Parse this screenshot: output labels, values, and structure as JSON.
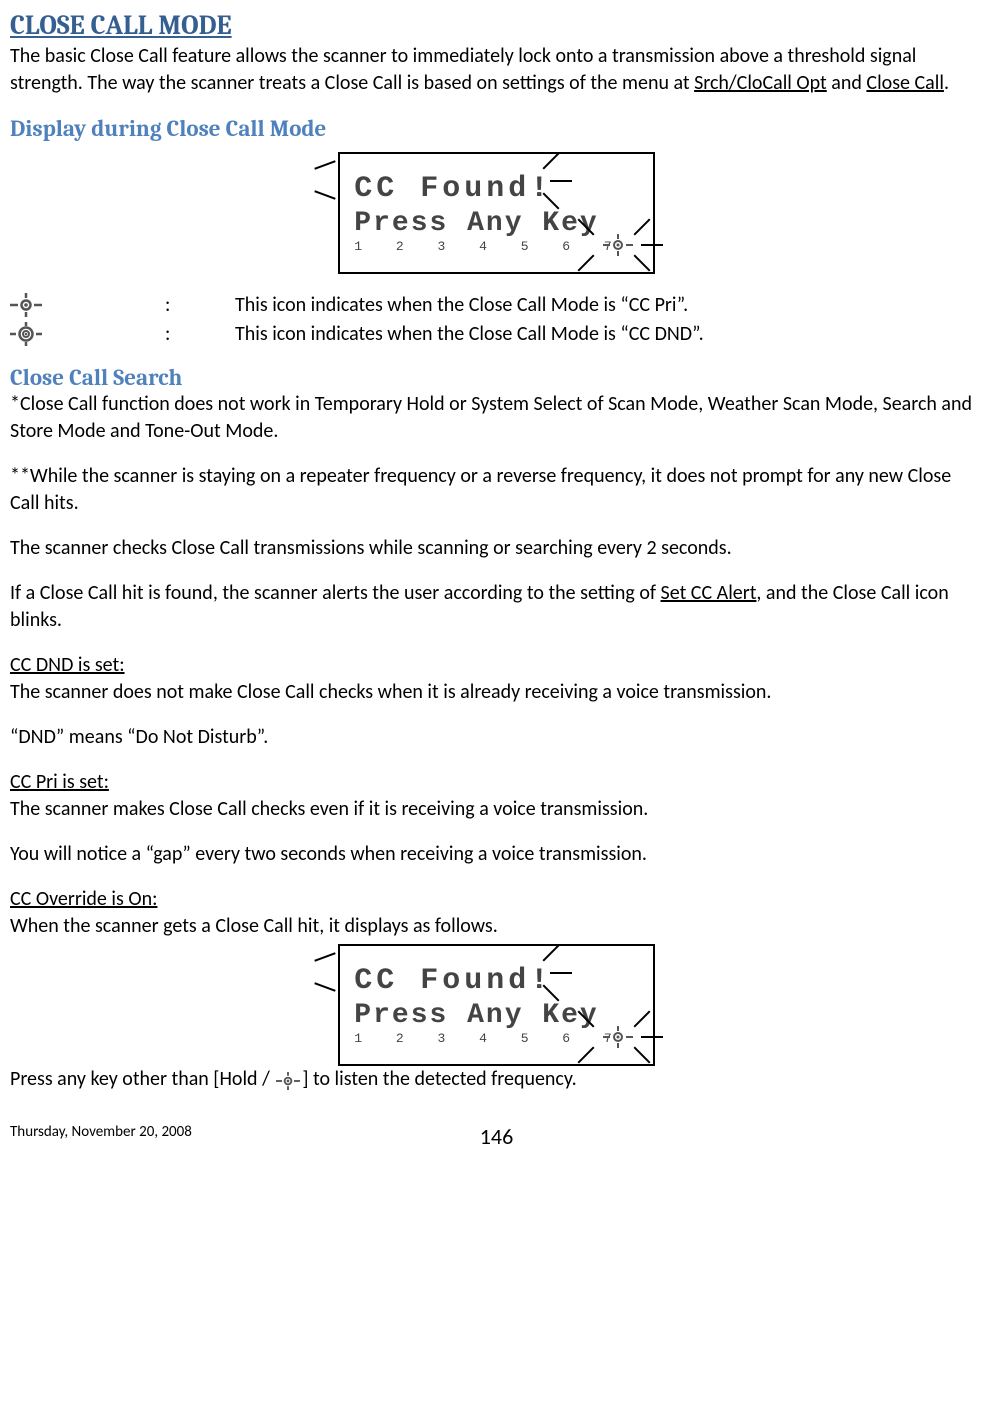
{
  "title": "CLOSE CALL MODE",
  "intro_1": "The basic Close Call feature allows the scanner to immediately lock onto a transmission above a threshold signal strength. The way the scanner treats a Close Call is based on settings of the menu at ",
  "intro_link1": "Srch/CloCall Opt",
  "intro_and": " and ",
  "intro_link2": "Close Call",
  "intro_end": ".",
  "h2_display": "Display during Close Call Mode",
  "lcd1_line1": "CC Found!",
  "lcd1_line2": "Press Any Key",
  "lcd1_line3": "1 2 3 4 5 6 7",
  "icon_row1_colon": ":",
  "icon_row1_desc": "This icon indicates when the Close Call Mode is “CC Pri”.",
  "icon_row2_colon": ":",
  "icon_row2_desc": "This icon indicates when the Close Call Mode is “CC DND”.",
  "h2_search": "Close Call Search",
  "ccs_p1": "*Close Call function does not work in Temporary Hold or System Select of Scan Mode,  Weather Scan Mode, Search and Store Mode and Tone-Out Mode.",
  "ccs_p2": "**While the scanner is staying on a repeater frequency or a reverse frequency, it does not prompt for any new Close Call hits.",
  "ccs_p3": "The scanner checks Close Call transmissions while scanning or searching every 2 seconds.",
  "ccs_p4a": "If a Close Call hit is found, the scanner alerts the user according to the setting of ",
  "ccs_p4_link": "Set CC Alert",
  "ccs_p4b": ", and the Close Call icon blinks.",
  "ccdnd_head": "CC DND is set:",
  "ccdnd_p1": "The scanner does not make Close Call checks when it is already receiving a voice transmission.",
  "ccdnd_p2": "“DND” means “Do Not Disturb”.",
  "ccpri_head": "CC Pri is set:",
  "ccpri_p1": "The scanner makes Close Call checks even if it is receiving a voice transmission.",
  "ccpri_p2": "You will notice a “gap” every two seconds when receiving a voice transmission.",
  "ccovr_head": "CC Override is On:",
  "ccovr_p1": "When the scanner gets a Close Call hit, it displays as follows.",
  "lcd2_line1": "CC Found!",
  "lcd2_line2": "Press Any Key",
  "lcd2_line3": "1 2 3 4 5 6 7",
  "press_any_a": "Press any key other than [Hold / ",
  "press_any_b": "] to listen the detected frequency.",
  "footer_date": "Thursday, November 20, 2008",
  "footer_page": "146"
}
